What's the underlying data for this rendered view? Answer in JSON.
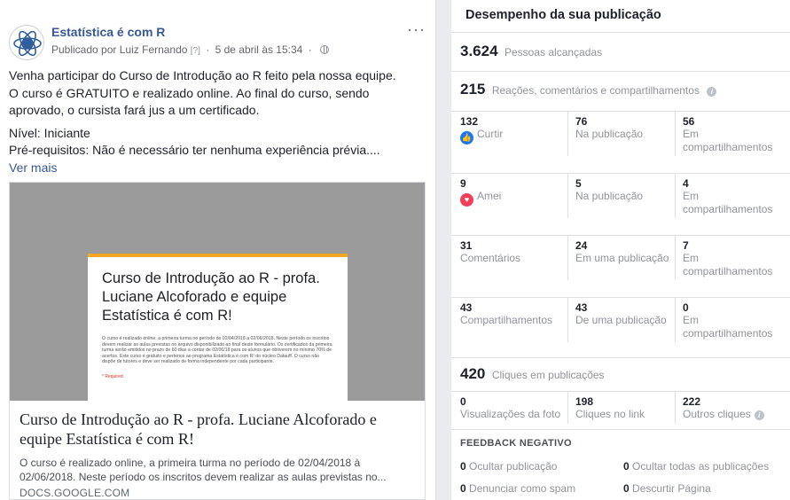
{
  "post": {
    "page_name": "Estatística é com R",
    "published_by": "Publicado por Luiz Fernando",
    "help_mark": "[?]",
    "date": "5 de abril às 15:34",
    "more_label": "···",
    "text_lines": [
      "Venha participar do Curso de Introdução ao R feito pela nossa equipe.",
      "O curso é GRATUITO e realizado online. Ao final do curso, sendo",
      "aprovado, o cursista fará jus a um certificado."
    ],
    "text_lines_2": [
      "Nível: Iniciante",
      "Pré-requisitos: Não é necessário ter nenhuma experiência prévia...."
    ],
    "see_more": "Ver mais",
    "link": {
      "preview_title": "Curso de Introdução ao R - profa. Luciane Alcoforado e equipe Estatística é com R!",
      "preview_body": "O curso é realizado online, a primeira turma no período de 02/04/2018 a 02/06/2018. Neste período os inscritos devem realizar as aulas previstas no arquivo disponibilizado ao final deste formulário. Os certificados da primeira turma serão emitidos no prazo de 60 dias a contar de 02/06/18 para os alunos que obtiverem no mínimo 70% de acertos. Este curso é gratuito e pertence ao programa Estatística é com R! do núcleo Datauff. O curso não dispõe de tutores e deve ser realizado de forma independente por cada participante.",
      "preview_required": "* Required",
      "headline": "Curso de Introdução ao R - profa. Luciane Alcoforado e equipe Estatística é com R!",
      "description": "O curso é realizado online, a primeira turma no período de 02/04/2018 à 02/06/2018. Neste período os inscritos devem realizar as aulas previstas no...",
      "domain": "DOCS.GOOGLE.COM"
    }
  },
  "insights": {
    "title": "Desempenho da sua publicação",
    "reach": {
      "value": "3.624",
      "label": "Pessoas alcançadas"
    },
    "engagement": {
      "value": "215",
      "label": "Reações, comentários e compartilhamentos"
    },
    "rows": [
      {
        "c1": {
          "value": "132",
          "label": "Curtir",
          "icon": "like-icon"
        },
        "c2": {
          "value": "76",
          "label": "Na publicação"
        },
        "c3": {
          "value": "56",
          "label": "Em compartilhamentos"
        }
      },
      {
        "c1": {
          "value": "9",
          "label": "Amei",
          "icon": "love-icon"
        },
        "c2": {
          "value": "5",
          "label": "Na publicação"
        },
        "c3": {
          "value": "4",
          "label": "Em compartilhamentos"
        }
      },
      {
        "c1": {
          "value": "31",
          "label": "Comentários"
        },
        "c2": {
          "value": "24",
          "label": "Em uma publicação"
        },
        "c3": {
          "value": "7",
          "label": "Em compartilhamentos"
        }
      },
      {
        "c1": {
          "value": "43",
          "label": "Compartilhamentos"
        },
        "c2": {
          "value": "43",
          "label": "De uma publicação"
        },
        "c3": {
          "value": "0",
          "label": "Em compartilhamentos"
        }
      }
    ],
    "clicks": {
      "value": "420",
      "label": "Cliques em publicações"
    },
    "click_row": {
      "c1": {
        "value": "0",
        "label": "Visualizações da foto"
      },
      "c2": {
        "value": "198",
        "label": "Cliques no link"
      },
      "c3": {
        "value": "222",
        "label": "Outros cliques"
      }
    },
    "negative": {
      "title": "FEEDBACK NEGATIVO",
      "items": [
        {
          "value": "0",
          "label": "Ocultar publicação"
        },
        {
          "value": "0",
          "label": "Ocultar todas as publicações"
        },
        {
          "value": "0",
          "label": "Denunciar como spam"
        },
        {
          "value": "0",
          "label": "Descurtir Página"
        }
      ]
    }
  }
}
